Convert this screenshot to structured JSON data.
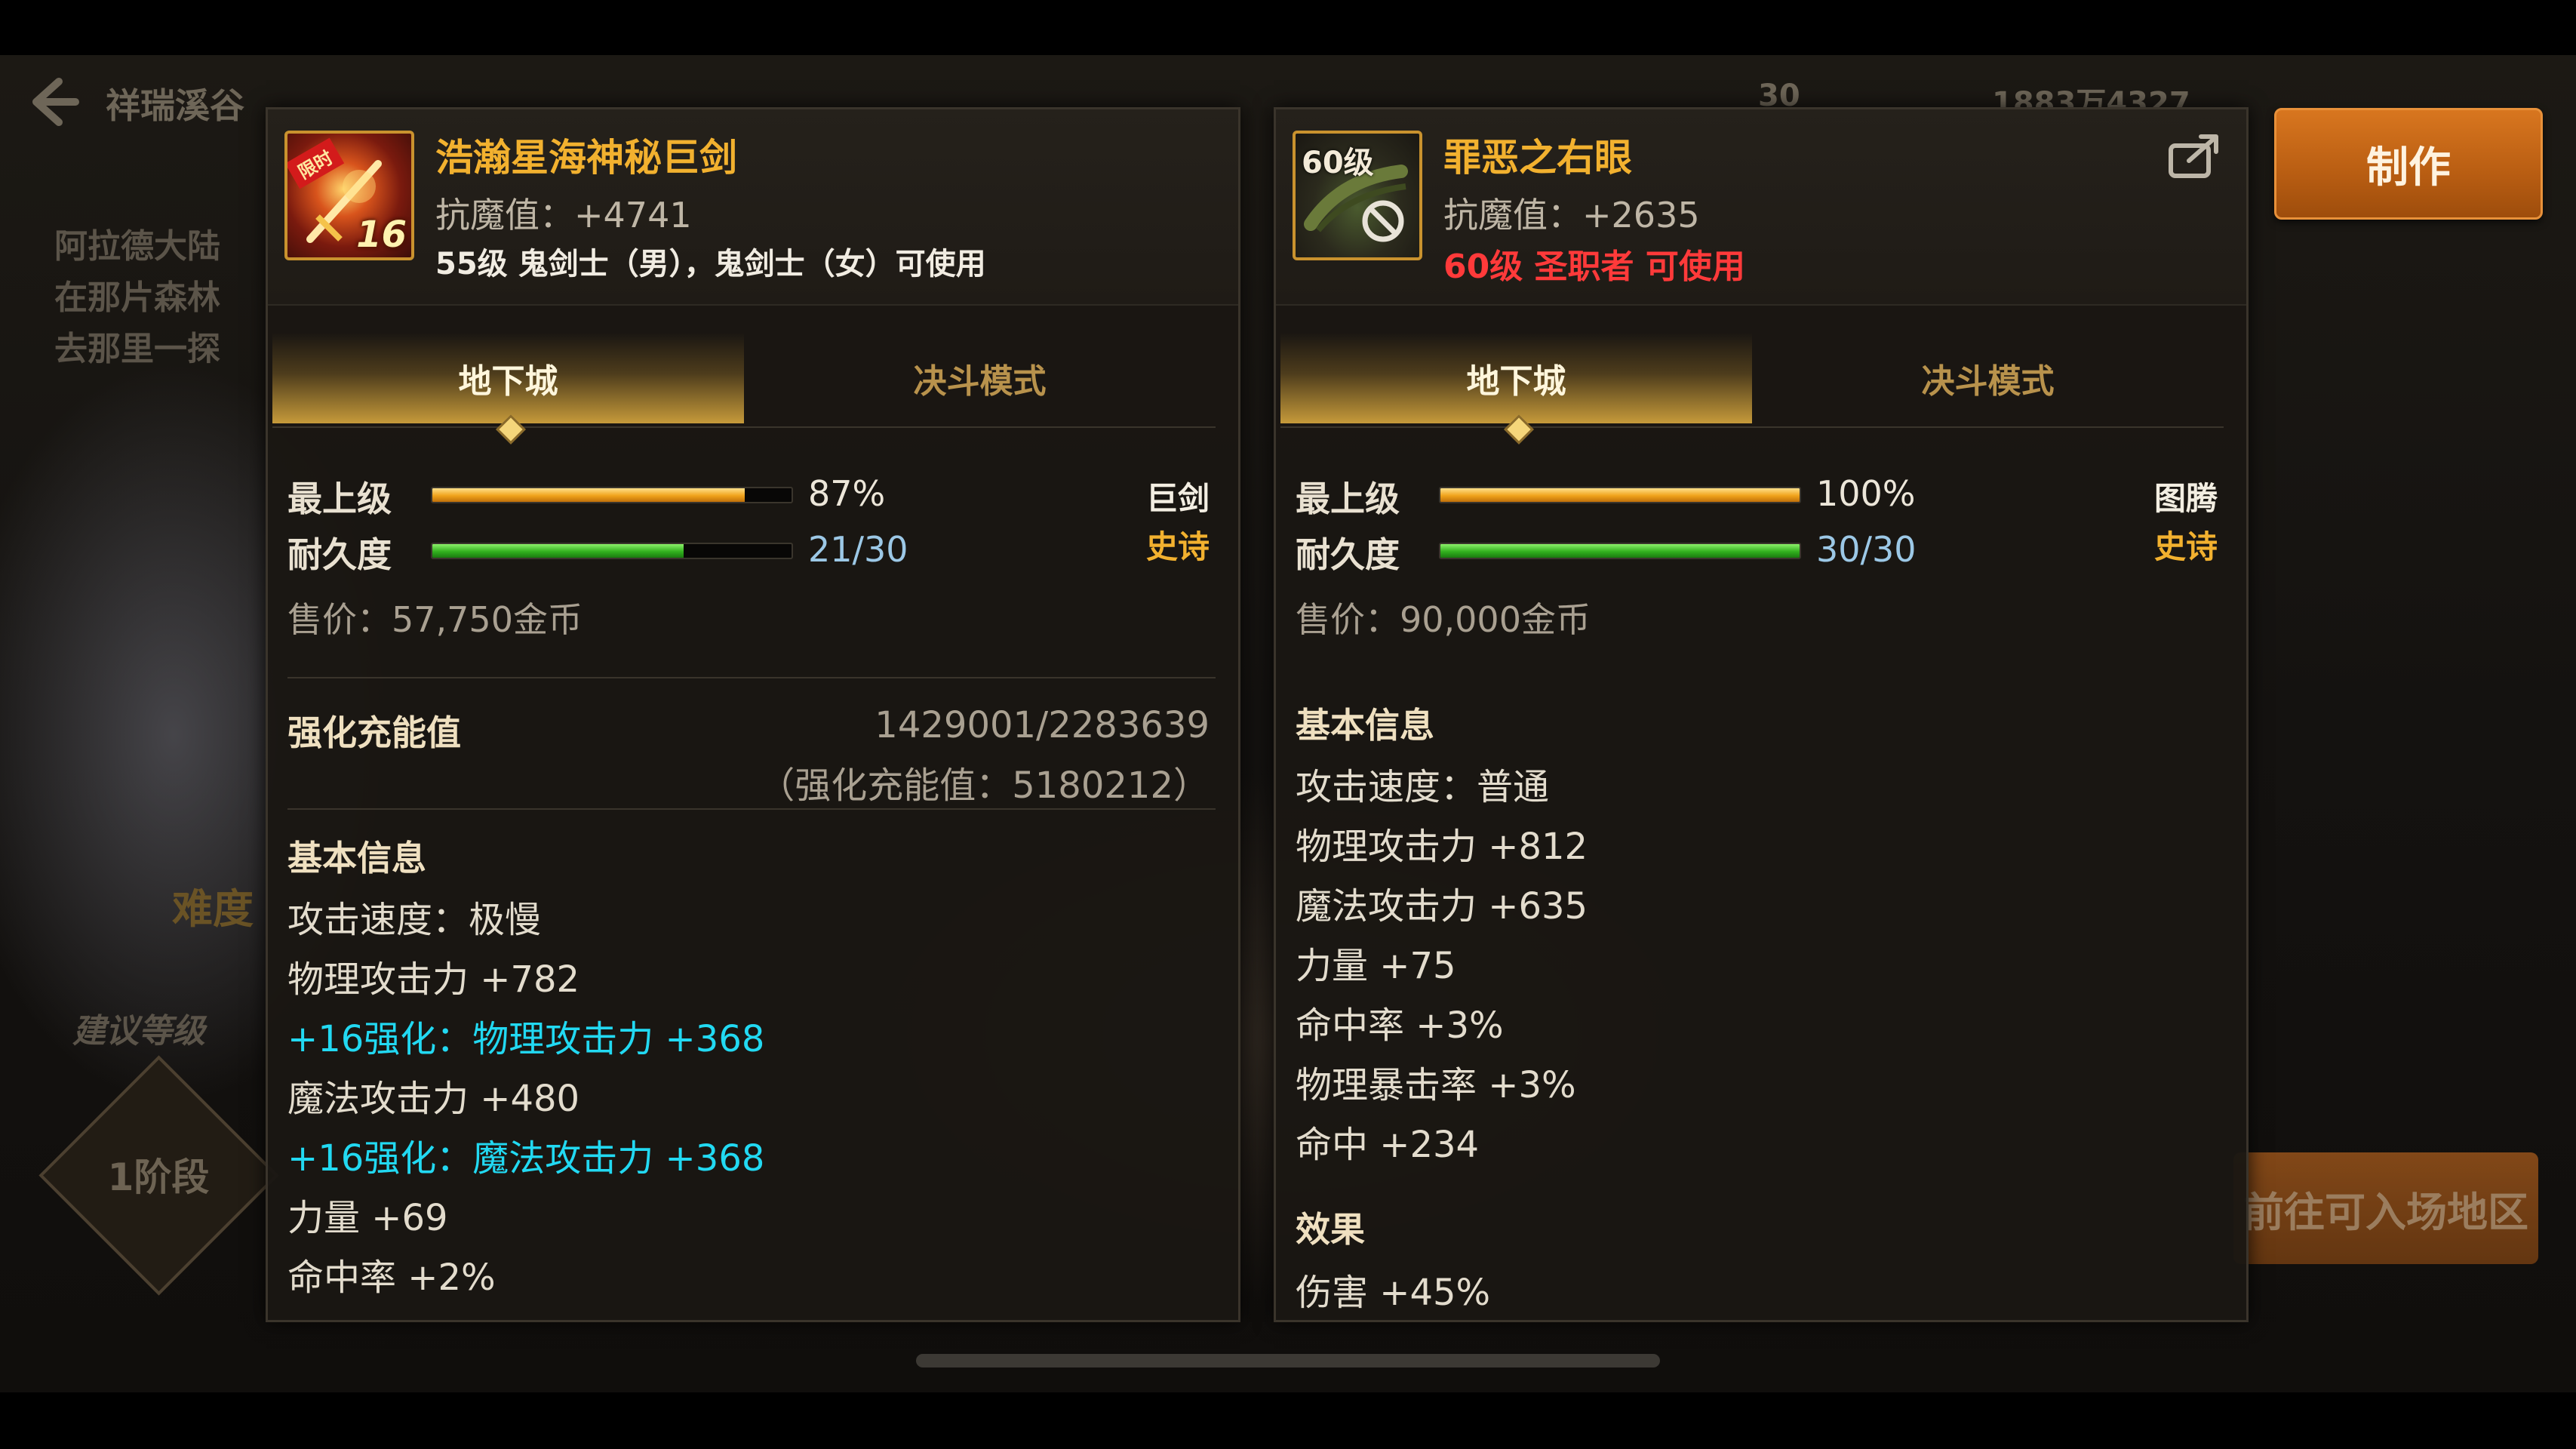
{
  "header": {
    "location_title": "祥瑞溪谷",
    "currency_1": "30",
    "currency_2": "1883万4327"
  },
  "background": {
    "description_lines": [
      "阿拉德大陆",
      "在那片森林",
      "去那里一探"
    ],
    "difficulty_label": "难度",
    "suggested_level_label": "建议等级",
    "stage_label": "1阶段",
    "goto_button_label": "前往可入场地区"
  },
  "make_button_label": "制作",
  "left_item": {
    "icon_name": "sword-item-icon",
    "icon_ribbon": "限时",
    "icon_badge": "16",
    "name": "浩瀚星海神秘巨剑",
    "resist": "抗魔值：+4741",
    "usable": "55级 鬼剑士（男），鬼剑士（女）可使用",
    "tabs": [
      "地下城",
      "决斗模式"
    ],
    "stats": [
      {
        "label": "最上级",
        "value": "87%",
        "fraction": 0.87,
        "color": "gold"
      },
      {
        "label": "耐久度",
        "value": "21/30",
        "fraction": 0.7,
        "color": "green"
      }
    ],
    "type": "巨剑",
    "rarity": "史诗",
    "price": "售价：57,750金币",
    "reinforce": {
      "title": "强化充能值",
      "value": "1429001/2283639",
      "sub": "（强化充能值：5180212）"
    },
    "basic_title": "基本信息",
    "lines": [
      {
        "text": "攻击速度：极慢",
        "highlight": false
      },
      {
        "text": "物理攻击力 +782",
        "highlight": false
      },
      {
        "text": "+16强化：物理攻击力 +368",
        "highlight": true
      },
      {
        "text": "魔法攻击力 +480",
        "highlight": false
      },
      {
        "text": "+16强化：魔法攻击力 +368",
        "highlight": true
      },
      {
        "text": "力量 +69",
        "highlight": false
      },
      {
        "text": "命中率 +2%",
        "highlight": false
      }
    ]
  },
  "right_item": {
    "icon_name": "cursed-eye-item-icon",
    "icon_level": "60级",
    "name": "罪恶之右眼",
    "resist": "抗魔值：+2635",
    "usable": "60级 圣职者 可使用",
    "tabs": [
      "地下城",
      "决斗模式"
    ],
    "stats": [
      {
        "label": "最上级",
        "value": "100%",
        "fraction": 1.0,
        "color": "gold"
      },
      {
        "label": "耐久度",
        "value": "30/30",
        "fraction": 1.0,
        "color": "green"
      }
    ],
    "type": "图腾",
    "rarity": "史诗",
    "price": "售价：90,000金币",
    "basic_title": "基本信息",
    "lines": [
      "攻击速度：普通",
      "物理攻击力 +812",
      "魔法攻击力 +635",
      "力量 +75",
      "命中率 +3%",
      "物理暴击率 +3%",
      "命中 +234"
    ],
    "effect_title": "效果",
    "effect_lines": [
      "伤害 +45%"
    ]
  },
  "colors": {
    "accent_gold": "#f2b12f",
    "highlight_cyan": "#22d9f2",
    "warning_red": "#ff3a3a",
    "make_orange": "#c8661a"
  }
}
